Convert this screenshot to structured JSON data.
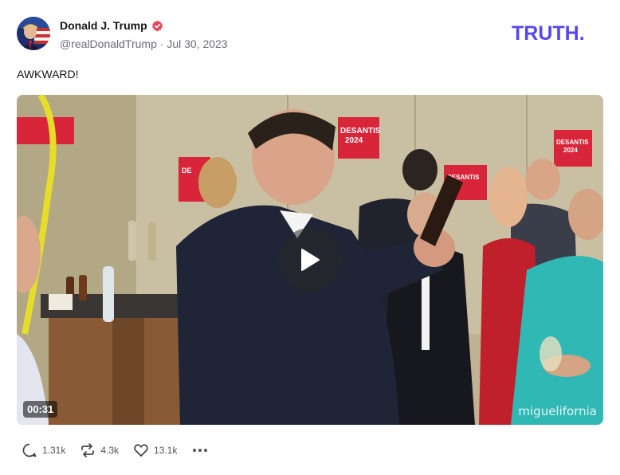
{
  "post": {
    "author_name": "Donald J. Trump",
    "handle": "@realDonaldTrump",
    "date": "Jul 30, 2023",
    "text": "AWKWARD!",
    "brand_logo": "TRUTH.",
    "brand_color": "#5448ee"
  },
  "video": {
    "duration": "00:31",
    "watermark": "miguelifornia",
    "sign_lines": [
      "DESANTIS",
      "2024"
    ]
  },
  "actions": {
    "replies": "1.31k",
    "retruths": "4.3k",
    "likes": "13.1k"
  },
  "colors": {
    "verified_badge": "#e9445a",
    "sign_red": "#d9253a"
  },
  "icons": [
    "verified-badge-icon",
    "play-icon",
    "reply-icon",
    "retruth-icon",
    "like-icon",
    "more-icon"
  ]
}
